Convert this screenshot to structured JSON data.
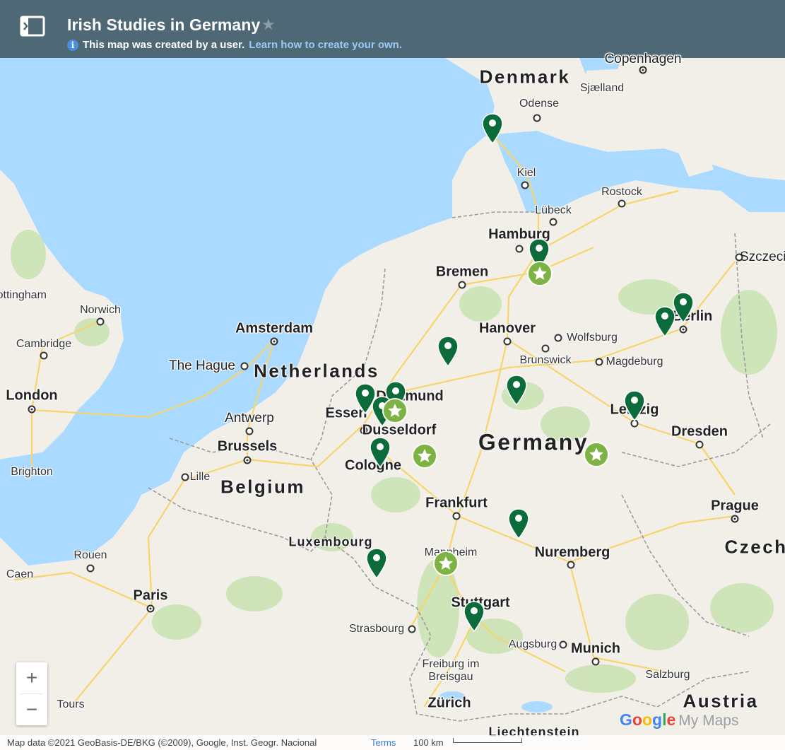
{
  "header": {
    "title": "Irish Studies in Germany",
    "notice": "This map was created by a user.",
    "learn_link": "Learn how to create your own."
  },
  "map": {
    "countries": [
      "Denmark",
      "Netherlands",
      "Belgium",
      "Germany",
      "Luxembourg",
      "Czech",
      "Austria",
      "Liechtenstein"
    ],
    "cities": [
      "Copenhagen",
      "Sjælland",
      "Odense",
      "Kiel",
      "Rostock",
      "Lübeck",
      "Hamburg",
      "Szczecin",
      "Bremen",
      "Hanover",
      "Wolfsburg",
      "Brunswick",
      "Magdeburg",
      "Berlin",
      "Amsterdam",
      "The Hague",
      "Norwich",
      "Cambridge",
      "Nottingham",
      "London",
      "Antwerp",
      "Brussels",
      "Brighton",
      "Lille",
      "Essen",
      "Dortmund",
      "Dusseldorf",
      "Cologne",
      "Leipzig",
      "Dresden",
      "Frankfurt",
      "Prague",
      "Nuremberg",
      "Mannheim",
      "Rouen",
      "Caen",
      "Paris",
      "Strasbourg",
      "Stuttgart",
      "Augsburg",
      "Munich",
      "Freiburg im Breisgau",
      "Salzburg",
      "Zürich",
      "Tours"
    ],
    "markers": {
      "pin_count": 16,
      "star_count": 6
    },
    "colors": {
      "water": "#aadaff",
      "land": "#f2efe9",
      "park": "#c8e2b0",
      "road": "#f7d56c",
      "pin": "#0b6b3a",
      "star": "#7cb342",
      "header": "#4e6875"
    }
  },
  "controls": {
    "zoom_in": "+",
    "zoom_out": "−"
  },
  "branding": {
    "google": "Google",
    "mymaps": "My Maps"
  },
  "footer": {
    "attribution": "Map data ©2021 GeoBasis-DE/BKG (©2009), Google, Inst. Geogr. Nacional",
    "terms": "Terms",
    "scale": "100 km"
  }
}
